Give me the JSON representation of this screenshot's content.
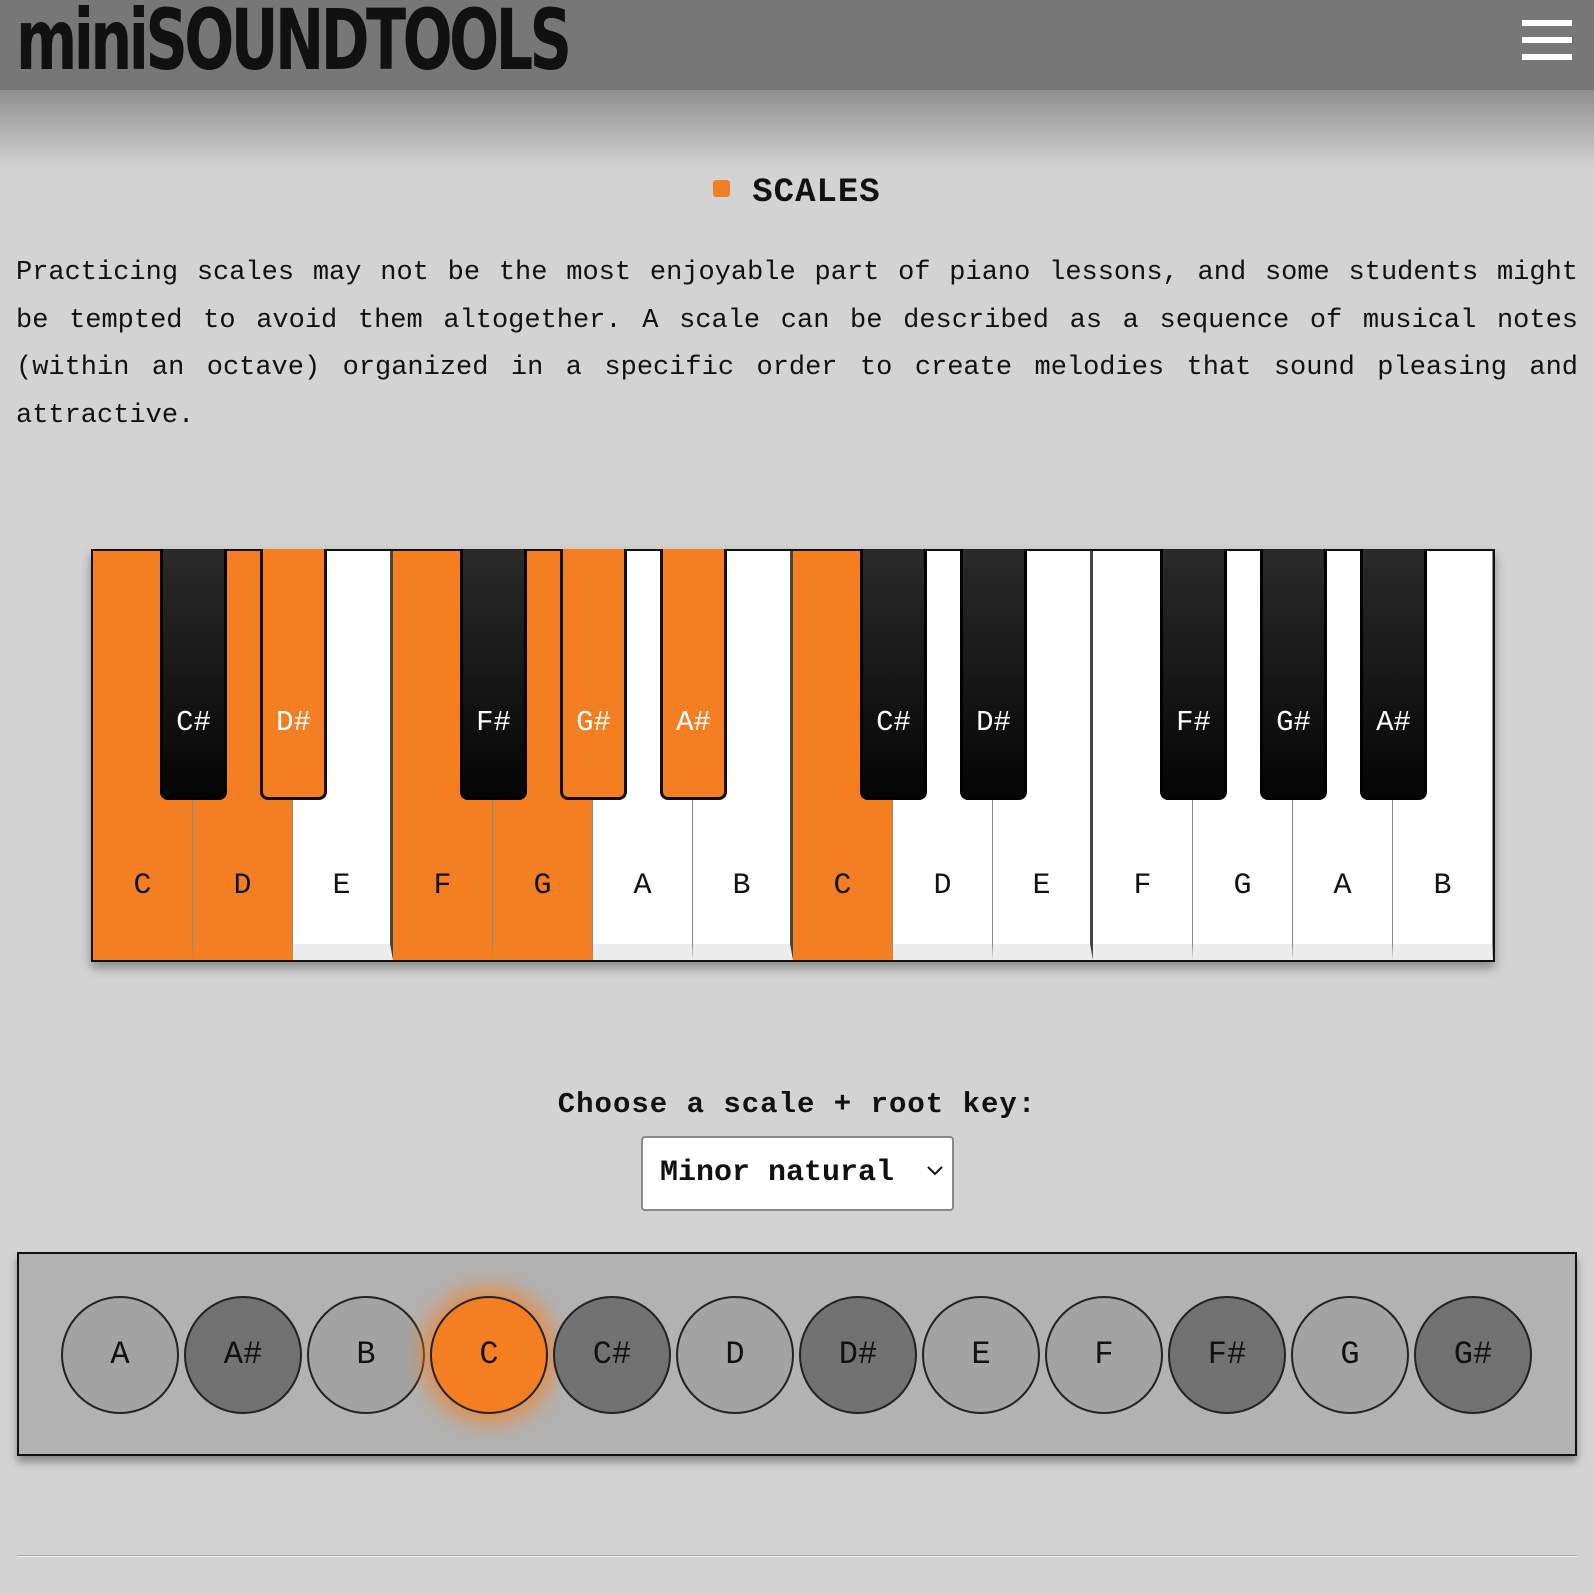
{
  "header": {
    "brand": "miniSOUNDTOOLS",
    "menu_icon": "hamburger-menu-icon"
  },
  "section": {
    "title": "SCALES",
    "intro": "Practicing scales may not be the most enjoyable part of piano lessons, and some students might be tempted to avoid them altogether. A scale can be described as a sequence of musical notes (within an octave) organized in a specific order to create melodies that sound pleasing and attractive."
  },
  "piano": {
    "white_keys": [
      {
        "label": "C",
        "active": true
      },
      {
        "label": "D",
        "active": true
      },
      {
        "label": "E",
        "active": false
      },
      {
        "label": "F",
        "active": true
      },
      {
        "label": "G",
        "active": true
      },
      {
        "label": "A",
        "active": false
      },
      {
        "label": "B",
        "active": false
      },
      {
        "label": "C",
        "active": true
      },
      {
        "label": "D",
        "active": false
      },
      {
        "label": "E",
        "active": false
      },
      {
        "label": "F",
        "active": false
      },
      {
        "label": "G",
        "active": false
      },
      {
        "label": "A",
        "active": false
      },
      {
        "label": "B",
        "active": false
      }
    ],
    "black_keys": [
      {
        "label": "C#",
        "active": false
      },
      {
        "label": "D#",
        "active": true
      },
      {
        "label": "F#",
        "active": false
      },
      {
        "label": "G#",
        "active": true
      },
      {
        "label": "A#",
        "active": true
      },
      {
        "label": "C#",
        "active": false
      },
      {
        "label": "D#",
        "active": false
      },
      {
        "label": "F#",
        "active": false
      },
      {
        "label": "G#",
        "active": false
      },
      {
        "label": "A#",
        "active": false
      }
    ],
    "highlight_color": "#f47f22"
  },
  "controls": {
    "choose_label": "Choose a scale + root key:",
    "scale_selected": "Minor natural",
    "chevron_icon": "chevron-down-icon"
  },
  "root_keys": {
    "selected": "C",
    "keys": [
      "A",
      "A#",
      "B",
      "C",
      "C#",
      "D",
      "D#",
      "E",
      "F",
      "F#",
      "G",
      "G#"
    ]
  }
}
